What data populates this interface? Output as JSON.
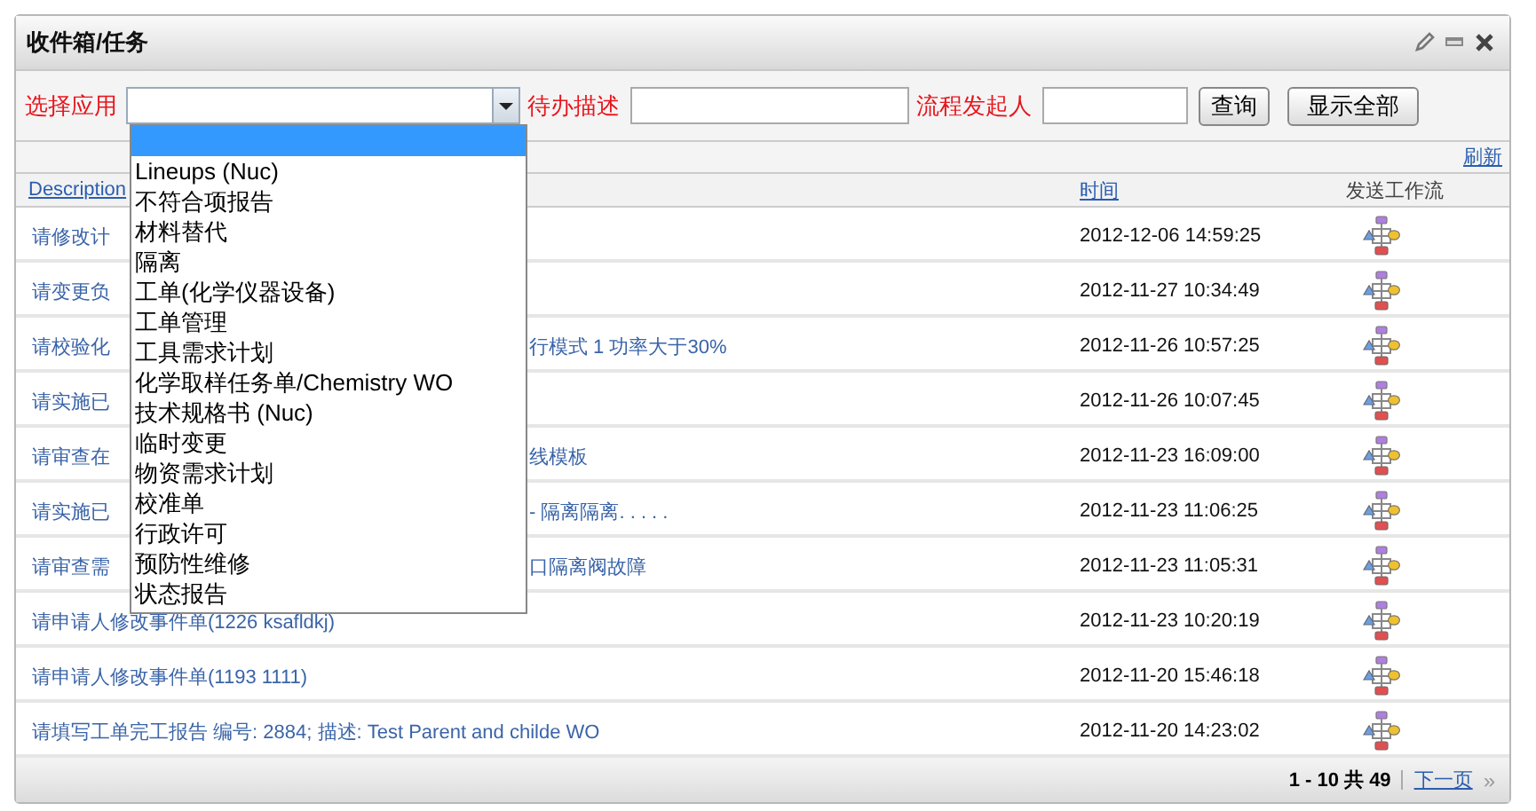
{
  "panel": {
    "title": "收件箱/任务"
  },
  "filters": {
    "app_label": "选择应用",
    "desc_label": "待办描述",
    "initiator_label": "流程发起人",
    "buttons": [
      "查询",
      "显示全部"
    ]
  },
  "dropdown": {
    "open": true,
    "blank_highlighted": true,
    "options": [
      {
        "label": "Lineups (Nuc)",
        "selected": false
      },
      {
        "label": "不符合项报告",
        "selected": false
      },
      {
        "label": "材料替代",
        "selected": false
      },
      {
        "label": "隔离",
        "selected": false
      },
      {
        "label": "工单(化学仪器设备)",
        "selected": false
      },
      {
        "label": "工单管理",
        "selected": false
      },
      {
        "label": "工具需求计划",
        "selected": false
      },
      {
        "label": "化学取样任务单/Chemistry WO",
        "selected": false
      },
      {
        "label": "技术规格书 (Nuc)",
        "selected": false
      },
      {
        "label": "临时变更",
        "selected": false
      },
      {
        "label": "物资需求计划",
        "selected": false
      },
      {
        "label": "校准单",
        "selected": false
      },
      {
        "label": "行政许可",
        "selected": false
      },
      {
        "label": "预防性维修",
        "selected": false
      },
      {
        "label": "状态报告",
        "selected": false
      }
    ]
  },
  "refresh": "刷新",
  "table": {
    "columns": [
      "Description",
      "时间",
      "发送工作流"
    ],
    "rows": [
      {
        "desc_left": "请修改计",
        "time": "2012-12-06 14:59:25"
      },
      {
        "desc_left": "请变更负",
        "time": "2012-11-27 10:34:49"
      },
      {
        "desc_left": "请校验化",
        "desc_right": "行模式  1 功率大于30%",
        "time": "2012-11-26 10:57:25"
      },
      {
        "desc_left": "请实施已",
        "time": "2012-11-26 10:07:45"
      },
      {
        "desc_left": "请审查在",
        "desc_right": "线模板",
        "time": "2012-11-23 16:09:00"
      },
      {
        "desc_left": "请实施已",
        "desc_right": "- 隔离隔离. . . . .",
        "time": "2012-11-23 11:06:25"
      },
      {
        "desc_left": "请审查需",
        "desc_right": "口隔离阀故障",
        "time": "2012-11-23 11:05:31"
      },
      {
        "desc_full": "请申请人修改事件单(1226 ksafldkj)",
        "time": "2012-11-23 10:20:19"
      },
      {
        "desc_full": "请申请人修改事件单(1193 1111)",
        "time": "2012-11-20 15:46:18"
      },
      {
        "desc_full": "请填写工单完工报告  编号: 2884; 描述: Test Parent and childe WO",
        "time": "2012-11-20 14:23:02"
      }
    ]
  },
  "pager": {
    "range": "1 - 10 共 49",
    "next": "下一页",
    "last": "»"
  }
}
